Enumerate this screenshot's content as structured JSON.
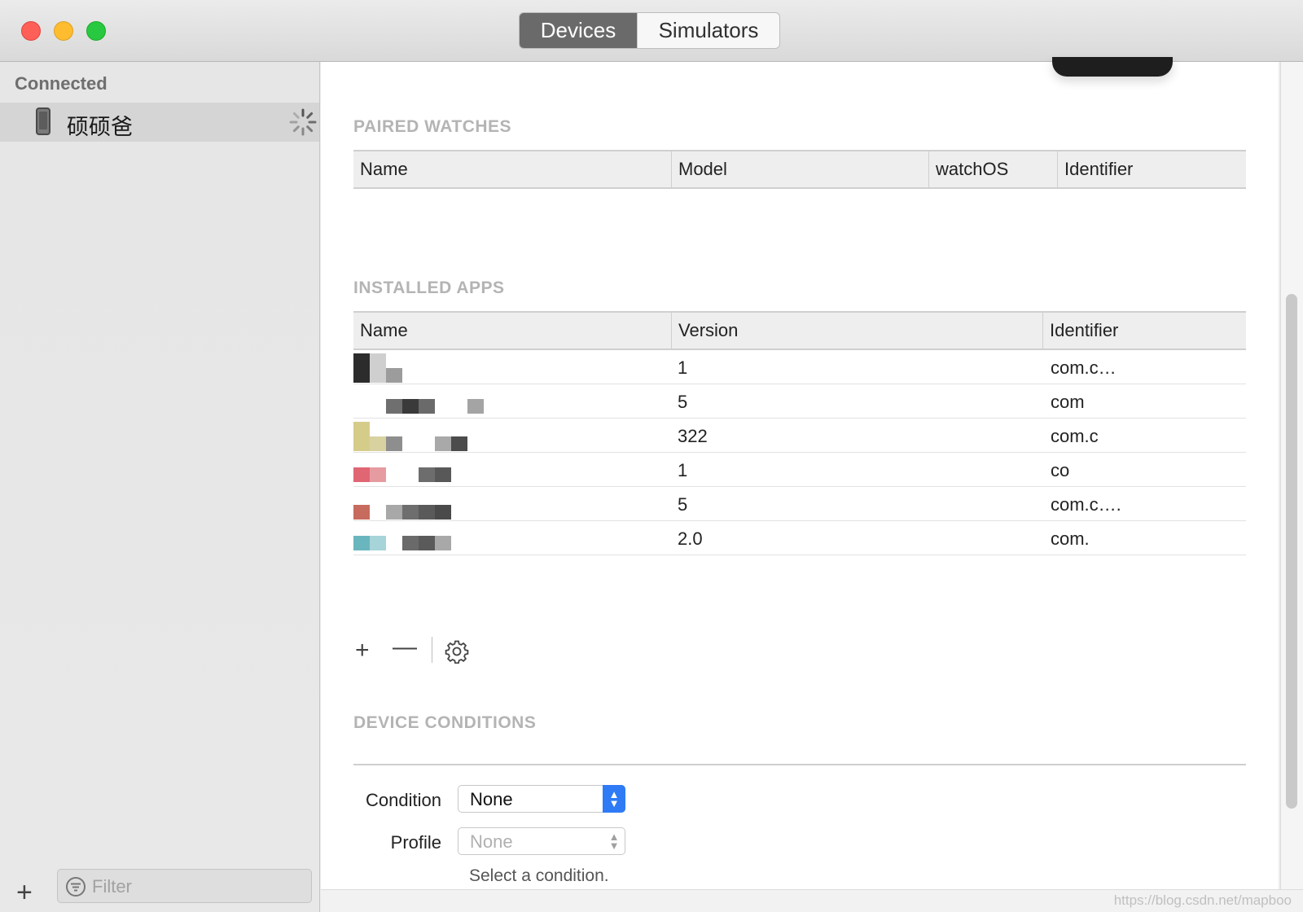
{
  "window": {
    "tabs": [
      {
        "label": "Devices",
        "active": true
      },
      {
        "label": "Simulators",
        "active": false
      }
    ]
  },
  "sidebar": {
    "section_header": "Connected",
    "devices": [
      {
        "name": "硕硕爸",
        "icon": "iphone-icon",
        "status": "loading-spinner"
      }
    ],
    "filter_placeholder": "Filter",
    "add_icon": "plus-icon"
  },
  "main": {
    "paired_watches": {
      "title": "PAIRED WATCHES",
      "columns": [
        "Name",
        "Model",
        "watchOS",
        "Identifier"
      ],
      "rows": []
    },
    "installed_apps": {
      "title": "INSTALLED APPS",
      "columns": [
        "Name",
        "Version",
        "Identifier"
      ],
      "rows": [
        {
          "version": "1",
          "identifier": "com.c…"
        },
        {
          "version": "5",
          "identifier": "com"
        },
        {
          "version": "322",
          "identifier": "com.c"
        },
        {
          "version": "1",
          "identifier": "co"
        },
        {
          "version": "5",
          "identifier": "com.c…."
        },
        {
          "version": "2.0",
          "identifier": "com."
        }
      ],
      "toolbar": {
        "add_label": "+",
        "remove_label": "—"
      }
    },
    "device_conditions": {
      "title": "DEVICE CONDITIONS",
      "condition_label": "Condition",
      "condition_value": "None",
      "profile_label": "Profile",
      "profile_value": "None",
      "hint": "Select a condition."
    }
  },
  "watermark": "https://blog.csdn.net/mapboo",
  "colors": {
    "accent": "#2f7bf6",
    "section_title": "#b4b4b4",
    "active_tab": "#6a6a6a"
  }
}
